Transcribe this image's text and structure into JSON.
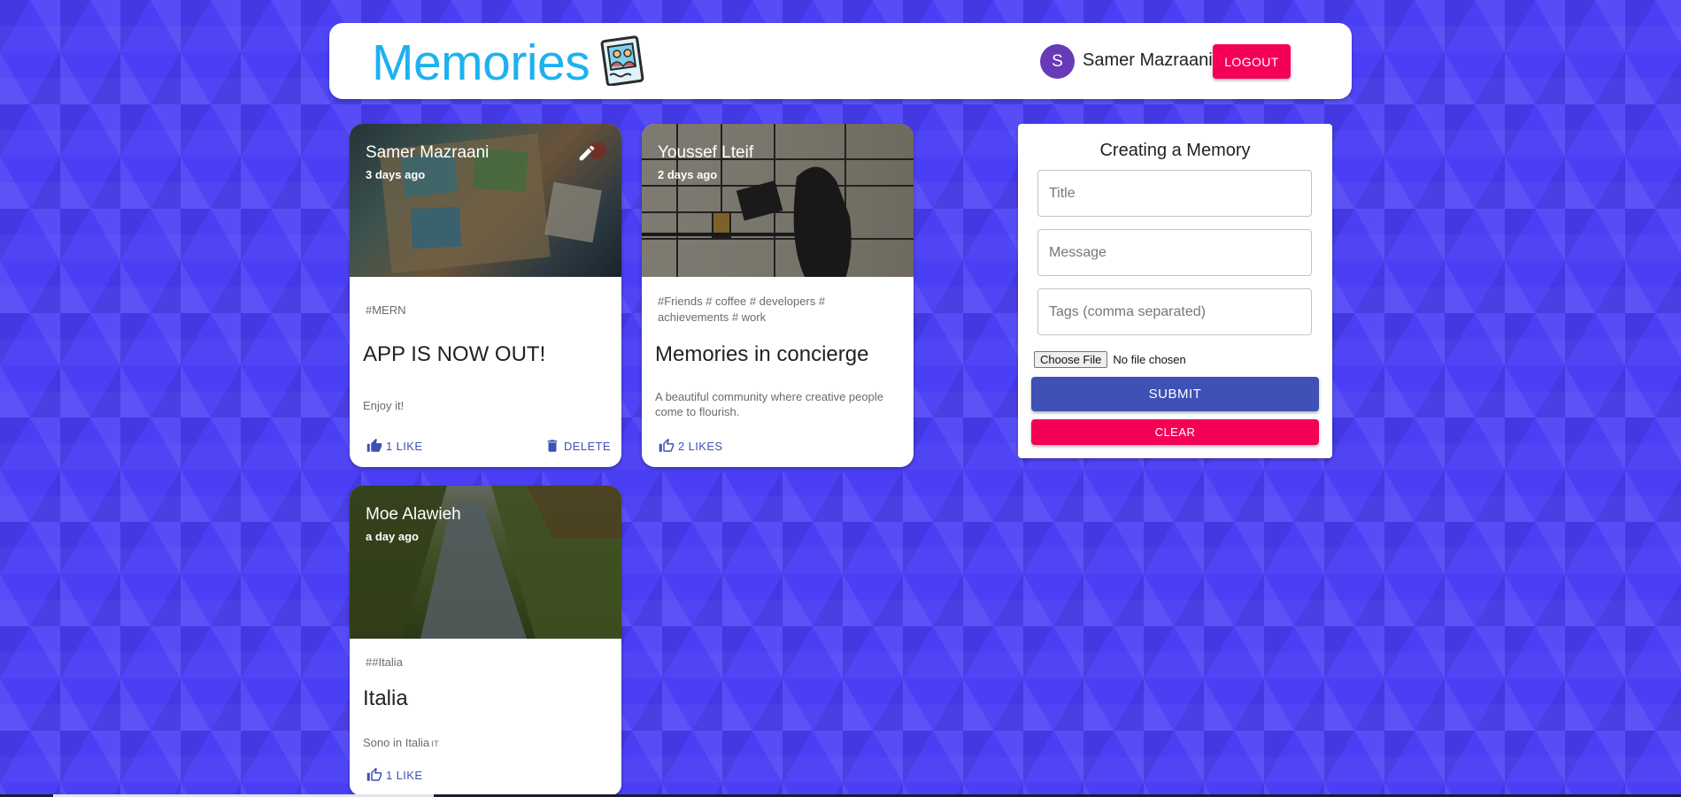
{
  "appbar": {
    "brand_title": "Memories",
    "user": {
      "avatar_letter": "S",
      "name": "Samer Mazraani"
    },
    "logout_label": "LOGOUT"
  },
  "posts": [
    {
      "author": "Samer Mazraani",
      "time": "3 days ago",
      "tags": "#MERN",
      "title": "APP IS NOW OUT!",
      "message": "Enjoy it!",
      "likes_label": "1 LIKE",
      "delete_label": "DELETE"
    },
    {
      "author": "Youssef Lteif",
      "time": "2 days ago",
      "tags": "#Friends # coffee # developers # achievements # work",
      "title": "Memories in concierge",
      "message": "A beautiful community where creative people come to flourish.",
      "likes_label": "2 LIKES"
    },
    {
      "author": "Moe Alawieh",
      "time": "a day ago",
      "tags": "##Italia",
      "title": "Italia",
      "message": "Sono in Italia",
      "message_suffix": "IT",
      "likes_label": "1 LIKE"
    }
  ],
  "form": {
    "title": "Creating a Memory",
    "title_placeholder": "Title",
    "message_placeholder": "Message",
    "tags_placeholder": "Tags (comma separated)",
    "choose_file_label": "Choose File",
    "file_status": "No file chosen",
    "submit_label": "SUBMIT",
    "clear_label": "CLEAR"
  },
  "colors": {
    "background": "#4a3ff5",
    "brand": "#1eb1f0",
    "primary": "#3f51b5",
    "secondary": "#f50057",
    "avatar": "#673ab7"
  }
}
